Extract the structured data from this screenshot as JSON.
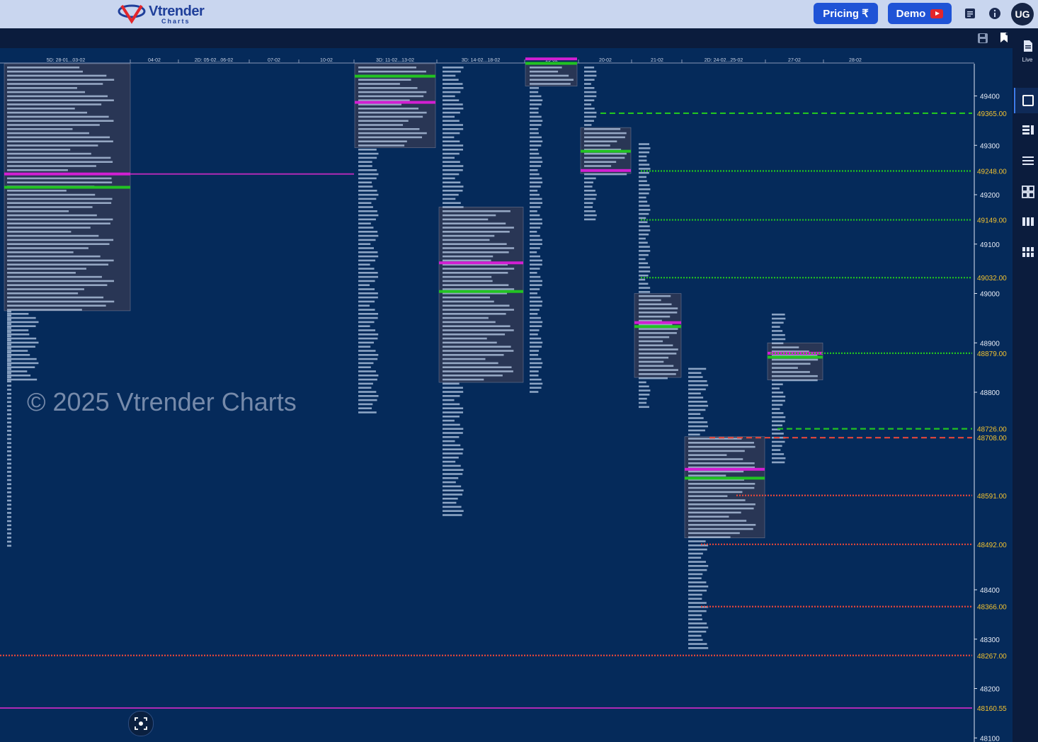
{
  "brand": {
    "name": "Vtrender",
    "sub": "Charts"
  },
  "header": {
    "pricing_label": "Pricing ₹",
    "demo_label": "Demo",
    "avatar": "UG",
    "icons": [
      "notes-icon",
      "info-icon"
    ]
  },
  "right_panel": {
    "live_label": "Live",
    "icons": [
      "document-icon",
      "square-icon",
      "list-layout-icon",
      "rows-icon",
      "grid-icon",
      "columns-icon",
      "tiles-icon"
    ]
  },
  "toolbar_icons": [
    "save-icon",
    "bookmark-icon"
  ],
  "watermark": "© 2025 Vtrender Charts",
  "colors": {
    "background": "#052a5a",
    "green": "#22c322",
    "red": "#e5473a",
    "purple": "#b12ab5",
    "magenta": "#d21fd2",
    "price_text": "#f2c230"
  },
  "chart_data": {
    "type": "market-profile",
    "dates": [
      "5D: 28-01...03-02",
      "04-02",
      "2D: 05-02...06-02",
      "07-02",
      "10-02",
      "3D: 11-02...13-02",
      "3D: 14-02...18-02",
      "19-02",
      "20-02",
      "21-02",
      "2D: 24-02...25-02",
      "27-02",
      "28-02"
    ],
    "y_ticks": [
      49400,
      49300,
      49200,
      49100,
      49000,
      48900,
      48800,
      48400,
      48300,
      48200,
      48100
    ],
    "levels": [
      {
        "label": "49365.00",
        "value": 49365,
        "color": "#22c322",
        "style": "dashed"
      },
      {
        "label": "49248.00",
        "value": 49248,
        "color": "#22c322",
        "style": "dotted"
      },
      {
        "label": "49149.00",
        "value": 49149,
        "color": "#22c322",
        "style": "dotted"
      },
      {
        "label": "49032.00",
        "value": 49032,
        "color": "#22c322",
        "style": "dotted"
      },
      {
        "label": "48879.00",
        "value": 48879,
        "color": "#22c322",
        "style": "dotted"
      },
      {
        "label": "48726.00",
        "value": 48726,
        "color": "#22c322",
        "style": "dashed"
      },
      {
        "label": "48708.00",
        "value": 48708,
        "color": "#e5473a",
        "style": "dashed"
      },
      {
        "label": "48591.00",
        "value": 48591,
        "color": "#e5473a",
        "style": "dotted"
      },
      {
        "label": "48492.00",
        "value": 48492,
        "color": "#e5473a",
        "style": "dotted"
      },
      {
        "label": "48366.00",
        "value": 48366,
        "color": "#e5473a",
        "style": "dotted"
      },
      {
        "label": "48267.00",
        "value": 48267,
        "color": "#e5473a",
        "style": "dotted"
      },
      {
        "label": "48160.55",
        "value": 48160.55,
        "color": "#b12ab5",
        "style": "solid"
      }
    ],
    "profiles": [
      {
        "date": "5D: 28-01...03-02",
        "high": 49480,
        "low": 48825,
        "va_high": 49480,
        "va_low": 48965,
        "poc": 49242,
        "vwap": 49215,
        "tail_low": 48485
      },
      {
        "date": "3D: 11-02...13-02",
        "high": 49480,
        "low": 48755,
        "va_high": 49480,
        "va_low": 49295,
        "poc": 49387,
        "vwap": 49440
      },
      {
        "date": "3D: 14-02...18-02",
        "high": 49480,
        "low": 48545,
        "va_high": 49175,
        "va_low": 48820,
        "poc": 49062,
        "vwap": 49004
      },
      {
        "date": "19-02",
        "high": 49480,
        "low": 48800,
        "va_high": 49480,
        "va_low": 49420,
        "poc": 49475,
        "vwap": 49466
      },
      {
        "date": "20-02",
        "high": 49480,
        "low": 49150,
        "va_high": 49336,
        "va_low": 49243,
        "poc": 49249,
        "vwap": 49288
      },
      {
        "date": "21-02",
        "high": 49310,
        "low": 48770,
        "va_high": 49000,
        "va_low": 48830,
        "poc": 48941,
        "vwap": 48933
      },
      {
        "date": "2D: 24-02...25-02",
        "high": 48855,
        "low": 48280,
        "va_high": 48710,
        "va_low": 48505,
        "poc": 48644,
        "vwap": 48626
      },
      {
        "date": "27-02",
        "high": 48965,
        "low": 48655,
        "va_high": 48900,
        "va_low": 48825,
        "poc": 48879,
        "vwap": 48871
      }
    ],
    "ylim": [
      48100,
      49480
    ]
  }
}
